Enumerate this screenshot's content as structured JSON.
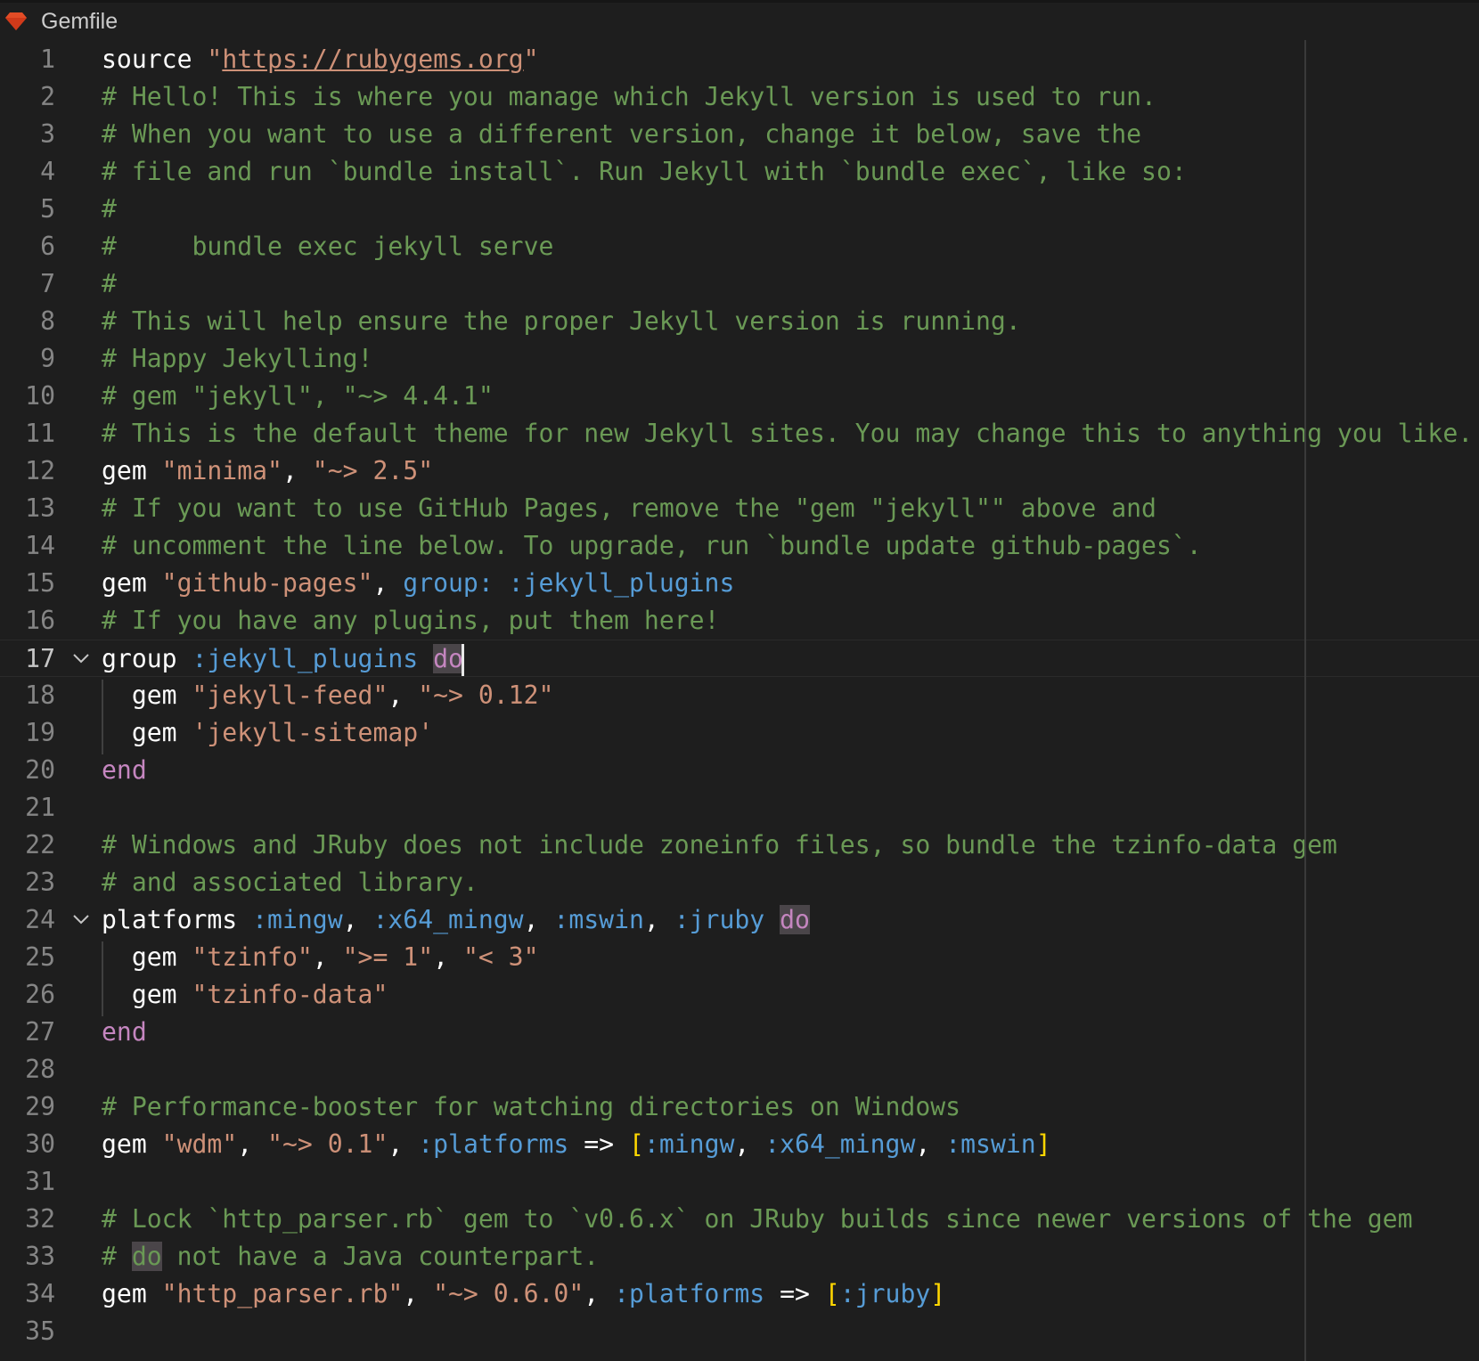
{
  "tab": {
    "title": "Gemfile",
    "icon": "ruby-gem-icon",
    "icon_color": "#e34c26"
  },
  "editor": {
    "current_line": 17,
    "lines": [
      {
        "n": "1",
        "tokens": [
          {
            "t": "source ",
            "c": "ident"
          },
          {
            "t": "\"",
            "c": "string"
          },
          {
            "t": "https://rubygems.org",
            "c": "link"
          },
          {
            "t": "\"",
            "c": "string"
          }
        ]
      },
      {
        "n": "2",
        "tokens": [
          {
            "t": "# Hello! This is where you manage which Jekyll version is used to run.",
            "c": "comment"
          }
        ]
      },
      {
        "n": "3",
        "tokens": [
          {
            "t": "# When you want to use a different version, change it below, save the",
            "c": "comment"
          }
        ]
      },
      {
        "n": "4",
        "tokens": [
          {
            "t": "# file and run `bundle install`. Run Jekyll with `bundle exec`, like so:",
            "c": "comment"
          }
        ]
      },
      {
        "n": "5",
        "tokens": [
          {
            "t": "#",
            "c": "comment"
          }
        ]
      },
      {
        "n": "6",
        "tokens": [
          {
            "t": "#     bundle exec jekyll serve",
            "c": "comment"
          }
        ]
      },
      {
        "n": "7",
        "tokens": [
          {
            "t": "#",
            "c": "comment"
          }
        ]
      },
      {
        "n": "8",
        "tokens": [
          {
            "t": "# This will help ensure the proper Jekyll version is running.",
            "c": "comment"
          }
        ]
      },
      {
        "n": "9",
        "tokens": [
          {
            "t": "# Happy Jekylling!",
            "c": "comment"
          }
        ]
      },
      {
        "n": "10",
        "tokens": [
          {
            "t": "# gem \"jekyll\", \"~> 4.4.1\"",
            "c": "comment"
          }
        ]
      },
      {
        "n": "11",
        "tokens": [
          {
            "t": "# This is the default theme for new Jekyll sites. You may change this to anything you like.",
            "c": "comment"
          }
        ]
      },
      {
        "n": "12",
        "tokens": [
          {
            "t": "gem ",
            "c": "ident"
          },
          {
            "t": "\"minima\"",
            "c": "string"
          },
          {
            "t": ", ",
            "c": "ident"
          },
          {
            "t": "\"~> 2.5\"",
            "c": "string"
          }
        ]
      },
      {
        "n": "13",
        "tokens": [
          {
            "t": "# If you want to use GitHub Pages, remove the \"gem \"jekyll\"\" above and",
            "c": "comment"
          }
        ]
      },
      {
        "n": "14",
        "tokens": [
          {
            "t": "# uncomment the line below. To upgrade, run `bundle update github-pages`.",
            "c": "comment"
          }
        ]
      },
      {
        "n": "15",
        "tokens": [
          {
            "t": "gem ",
            "c": "ident"
          },
          {
            "t": "\"github-pages\"",
            "c": "string"
          },
          {
            "t": ", ",
            "c": "ident"
          },
          {
            "t": "group: :jekyll_plugins",
            "c": "symbol"
          }
        ]
      },
      {
        "n": "16",
        "tokens": [
          {
            "t": "# If you have any plugins, put them here!",
            "c": "comment"
          }
        ]
      },
      {
        "n": "17",
        "fold": true,
        "tokens": [
          {
            "t": "group ",
            "c": "ident"
          },
          {
            "t": ":jekyll_plugins",
            "c": "symbol"
          },
          {
            "t": " ",
            "c": "ident"
          },
          {
            "t": "do",
            "c": "keyword hl"
          },
          {
            "t": "",
            "c": "cursor"
          }
        ]
      },
      {
        "n": "18",
        "tokens": [
          {
            "t": "  gem ",
            "c": "ident"
          },
          {
            "t": "\"jekyll-feed\"",
            "c": "string"
          },
          {
            "t": ", ",
            "c": "ident"
          },
          {
            "t": "\"~> 0.12\"",
            "c": "string"
          }
        ]
      },
      {
        "n": "19",
        "tokens": [
          {
            "t": "  gem ",
            "c": "ident"
          },
          {
            "t": "'jekyll-sitemap'",
            "c": "string"
          }
        ]
      },
      {
        "n": "20",
        "tokens": [
          {
            "t": "end",
            "c": "keyword"
          }
        ]
      },
      {
        "n": "21",
        "tokens": []
      },
      {
        "n": "22",
        "tokens": [
          {
            "t": "# Windows and JRuby does not include zoneinfo files, so bundle the tzinfo-data gem",
            "c": "comment"
          }
        ]
      },
      {
        "n": "23",
        "tokens": [
          {
            "t": "# and associated library.",
            "c": "comment"
          }
        ]
      },
      {
        "n": "24",
        "fold": true,
        "tokens": [
          {
            "t": "platforms ",
            "c": "ident"
          },
          {
            "t": ":mingw",
            "c": "symbol"
          },
          {
            "t": ", ",
            "c": "ident"
          },
          {
            "t": ":x64_mingw",
            "c": "symbol"
          },
          {
            "t": ", ",
            "c": "ident"
          },
          {
            "t": ":mswin",
            "c": "symbol"
          },
          {
            "t": ", ",
            "c": "ident"
          },
          {
            "t": ":jruby",
            "c": "symbol"
          },
          {
            "t": " ",
            "c": "ident"
          },
          {
            "t": "do",
            "c": "keyword hl"
          }
        ]
      },
      {
        "n": "25",
        "tokens": [
          {
            "t": "  gem ",
            "c": "ident"
          },
          {
            "t": "\"tzinfo\"",
            "c": "string"
          },
          {
            "t": ", ",
            "c": "ident"
          },
          {
            "t": "\">= 1\"",
            "c": "string"
          },
          {
            "t": ", ",
            "c": "ident"
          },
          {
            "t": "\"< 3\"",
            "c": "string"
          }
        ]
      },
      {
        "n": "26",
        "tokens": [
          {
            "t": "  gem ",
            "c": "ident"
          },
          {
            "t": "\"tzinfo-data\"",
            "c": "string"
          }
        ]
      },
      {
        "n": "27",
        "tokens": [
          {
            "t": "end",
            "c": "keyword"
          }
        ]
      },
      {
        "n": "28",
        "tokens": []
      },
      {
        "n": "29",
        "tokens": [
          {
            "t": "# Performance-booster for watching directories on Windows",
            "c": "comment"
          }
        ]
      },
      {
        "n": "30",
        "tokens": [
          {
            "t": "gem ",
            "c": "ident"
          },
          {
            "t": "\"wdm\"",
            "c": "string"
          },
          {
            "t": ", ",
            "c": "ident"
          },
          {
            "t": "\"~> 0.1\"",
            "c": "string"
          },
          {
            "t": ", ",
            "c": "ident"
          },
          {
            "t": ":platforms",
            "c": "symbol"
          },
          {
            "t": " => ",
            "c": "ident"
          },
          {
            "t": "[",
            "c": "bracket"
          },
          {
            "t": ":mingw",
            "c": "symbol"
          },
          {
            "t": ", ",
            "c": "ident"
          },
          {
            "t": ":x64_mingw",
            "c": "symbol"
          },
          {
            "t": ", ",
            "c": "ident"
          },
          {
            "t": ":mswin",
            "c": "symbol"
          },
          {
            "t": "]",
            "c": "bracket"
          }
        ]
      },
      {
        "n": "31",
        "tokens": []
      },
      {
        "n": "32",
        "tokens": [
          {
            "t": "# Lock `http_parser.rb` gem to `v0.6.x` on JRuby builds since newer versions of the gem",
            "c": "comment"
          }
        ]
      },
      {
        "n": "33",
        "tokens": [
          {
            "t": "# ",
            "c": "comment"
          },
          {
            "t": "do",
            "c": "comment hl"
          },
          {
            "t": " not have a Java counterpart.",
            "c": "comment"
          }
        ]
      },
      {
        "n": "34",
        "tokens": [
          {
            "t": "gem ",
            "c": "ident"
          },
          {
            "t": "\"http_parser.rb\"",
            "c": "string"
          },
          {
            "t": ", ",
            "c": "ident"
          },
          {
            "t": "\"~> 0.6.0\"",
            "c": "string"
          },
          {
            "t": ", ",
            "c": "ident"
          },
          {
            "t": ":platforms",
            "c": "symbol"
          },
          {
            "t": " => ",
            "c": "ident"
          },
          {
            "t": "[",
            "c": "bracket"
          },
          {
            "t": ":jruby",
            "c": "symbol"
          },
          {
            "t": "]",
            "c": "bracket"
          }
        ]
      },
      {
        "n": "35",
        "tokens": []
      }
    ]
  }
}
